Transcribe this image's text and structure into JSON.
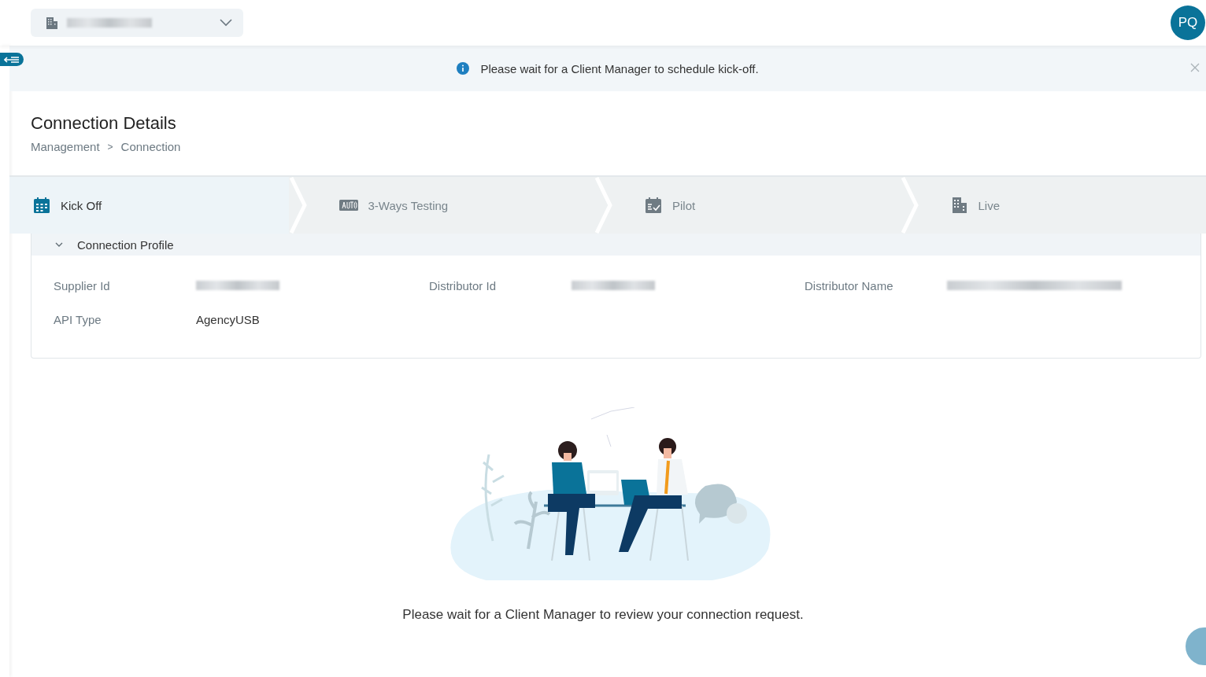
{
  "header": {
    "avatar": "PQ"
  },
  "banner": {
    "message": "Please wait for a Client Manager to schedule kick-off."
  },
  "page": {
    "title": "Connection Details",
    "breadcrumb": [
      "Management",
      "Connection"
    ],
    "breadcrumb_separator": ">"
  },
  "steps": [
    {
      "label": "Kick Off",
      "kind": "calendar",
      "selected": true
    },
    {
      "label": "3-Ways Testing",
      "kind": "auto",
      "selected": false
    },
    {
      "label": "Pilot",
      "kind": "checklist",
      "selected": false
    },
    {
      "label": "Live",
      "kind": "building",
      "selected": false
    }
  ],
  "profile": {
    "title": "Connection Profile",
    "expanded": true,
    "fields": [
      {
        "label": "Supplier Id"
      },
      {
        "label": "Distributor Id"
      },
      {
        "label": "Distributor Name"
      },
      {
        "label": "API Type",
        "value": "AgencyUSB"
      }
    ]
  },
  "empty_state": {
    "message": "Please wait for a Client Manager to review your connection request."
  }
}
